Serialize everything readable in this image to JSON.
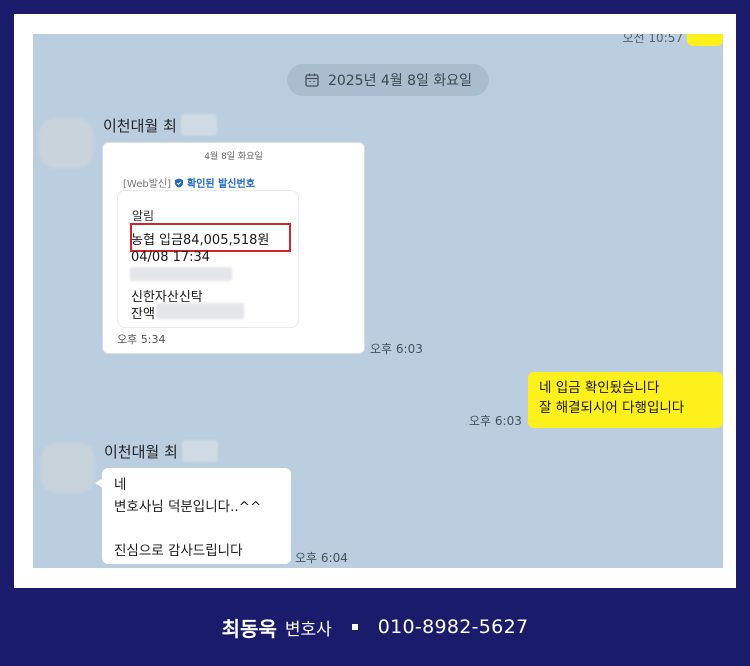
{
  "top_partial": {
    "time": "오전 10:57"
  },
  "date_divider": {
    "label": "2025년 4월 8일 화요일",
    "icon": "calendar-icon"
  },
  "messages": [
    {
      "sender": "이천대월 최",
      "card": {
        "date": "4월 8일 화요일",
        "from_prefix": "[Web발신]",
        "from_verified": "확인된 발신번호",
        "title": "알림",
        "deposit": "농협 입금84,005,518원",
        "datetime": "04/08 17:34",
        "bank": "신한자산신탁",
        "balance_label": "잔액",
        "sent_time": "오후 5:34"
      },
      "time": "오후 6:03"
    },
    {
      "mine": true,
      "lines": [
        "네 입금 확인됬습니다",
        "잘 해결되시어 다행입니다"
      ],
      "time": "오후 6:03"
    },
    {
      "sender": "이천대월 최",
      "lines": [
        "네",
        "변호사님 덕분입니다..^^",
        "",
        "진심으로 감사드립니다"
      ],
      "time": "오후 6:04"
    }
  ],
  "footer": {
    "name": "최동욱",
    "title": "변호사",
    "phone": "010-8982-5627"
  },
  "colors": {
    "background": "#1b1b6b",
    "chat_bg": "#bacee0",
    "my_bubble": "#fef01b",
    "highlight": "#d4232b"
  }
}
